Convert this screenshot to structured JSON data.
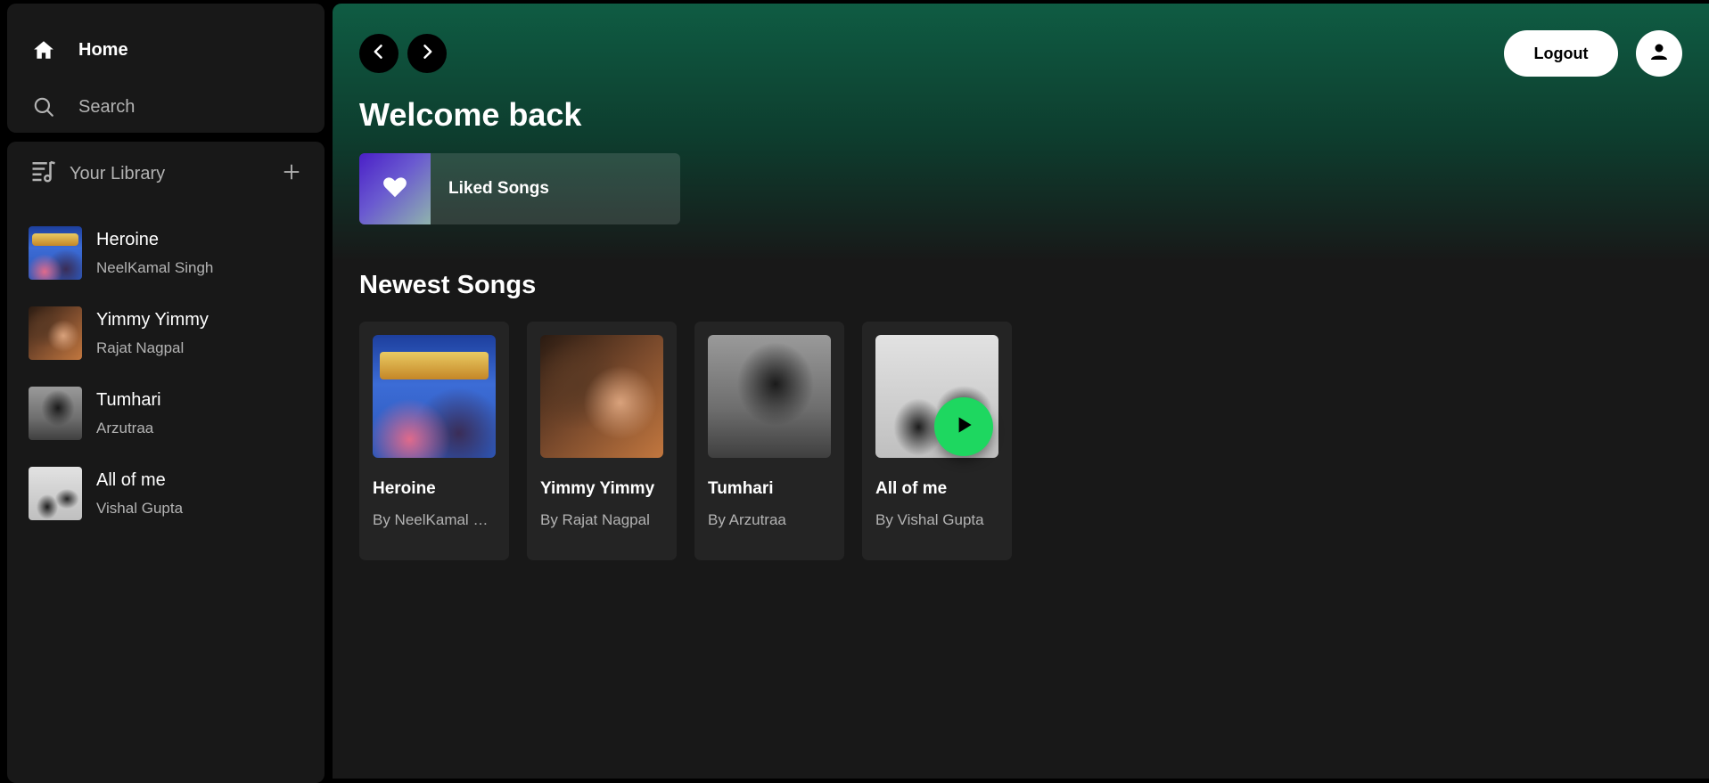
{
  "sidebar": {
    "nav": [
      {
        "label": "Home",
        "icon": "home-icon"
      },
      {
        "label": "Search",
        "icon": "search-icon"
      }
    ],
    "library": {
      "title": "Your Library",
      "items": [
        {
          "title": "Heroine",
          "artist": "NeelKamal Singh"
        },
        {
          "title": "Yimmy Yimmy",
          "artist": "Rajat Nagpal"
        },
        {
          "title": "Tumhari",
          "artist": "Arzutraa"
        },
        {
          "title": "All of me",
          "artist": "Vishal Gupta"
        }
      ]
    }
  },
  "header": {
    "logout_label": "Logout"
  },
  "main": {
    "welcome": "Welcome back",
    "liked_label": "Liked Songs",
    "newest_title": "Newest Songs",
    "cards": [
      {
        "title": "Heroine",
        "subtitle": "By NeelKamal Singh"
      },
      {
        "title": "Yimmy Yimmy",
        "subtitle": "By Rajat Nagpal"
      },
      {
        "title": "Tumhari",
        "subtitle": "By Arzutraa"
      },
      {
        "title": "All of me",
        "subtitle": "By Vishal Gupta"
      }
    ]
  },
  "colors": {
    "accent": "#1ed760",
    "panel": "#181818",
    "card": "#242424",
    "gradient_top": "#0f5c43"
  }
}
